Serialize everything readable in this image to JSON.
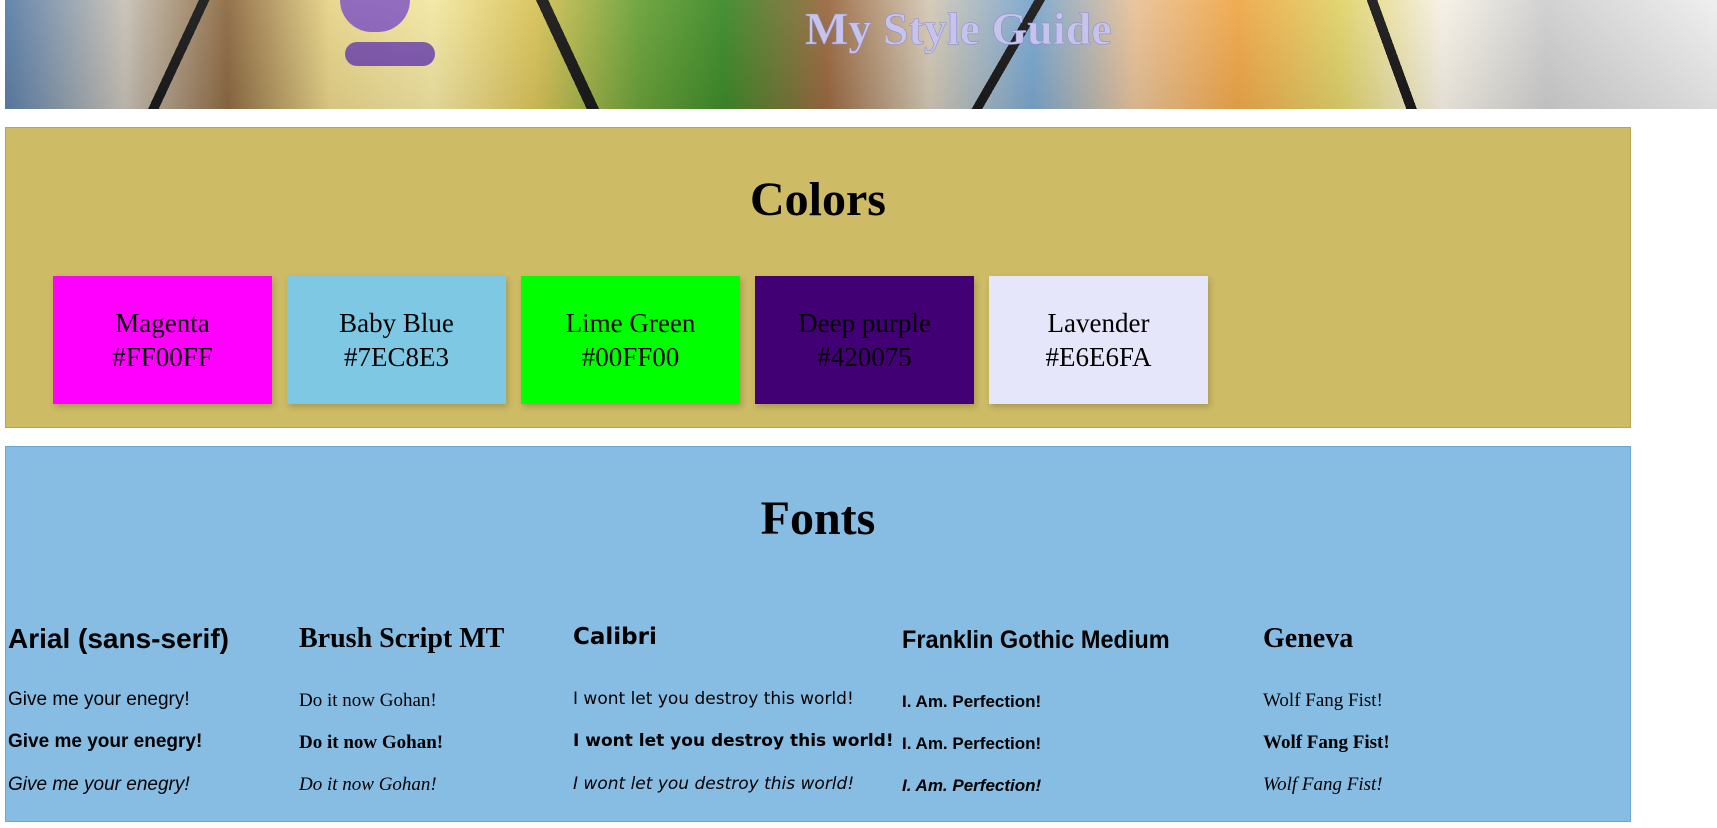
{
  "header": {
    "title": "My Style Guide"
  },
  "colors": {
    "heading": "Colors",
    "swatches": [
      {
        "name": "Magenta",
        "hex": "#FF00FF"
      },
      {
        "name": "Baby Blue",
        "hex": "#7EC8E3"
      },
      {
        "name": "Lime Green",
        "hex": "#00FF00"
      },
      {
        "name": "Deep purple",
        "hex": "#420075"
      },
      {
        "name": "Lavender",
        "hex": "#E6E6FA"
      }
    ]
  },
  "fonts": {
    "heading": "Fonts",
    "columns": [
      {
        "name": "Arial (sans-serif)",
        "sample": "Give me your enegry!"
      },
      {
        "name": "Brush Script MT",
        "sample": "Do it now Gohan!"
      },
      {
        "name": "Calibri",
        "sample": "I wont let you destroy this world!"
      },
      {
        "name": "Franklin Gothic Medium",
        "sample": "I. Am. Perfection!"
      },
      {
        "name": "Geneva",
        "sample": "Wolf Fang Fist!"
      }
    ]
  },
  "theme": {
    "colors_section_bg": "#CDBB65",
    "fonts_section_bg": "#87BDE3",
    "title_color": "#C6C4EC"
  }
}
